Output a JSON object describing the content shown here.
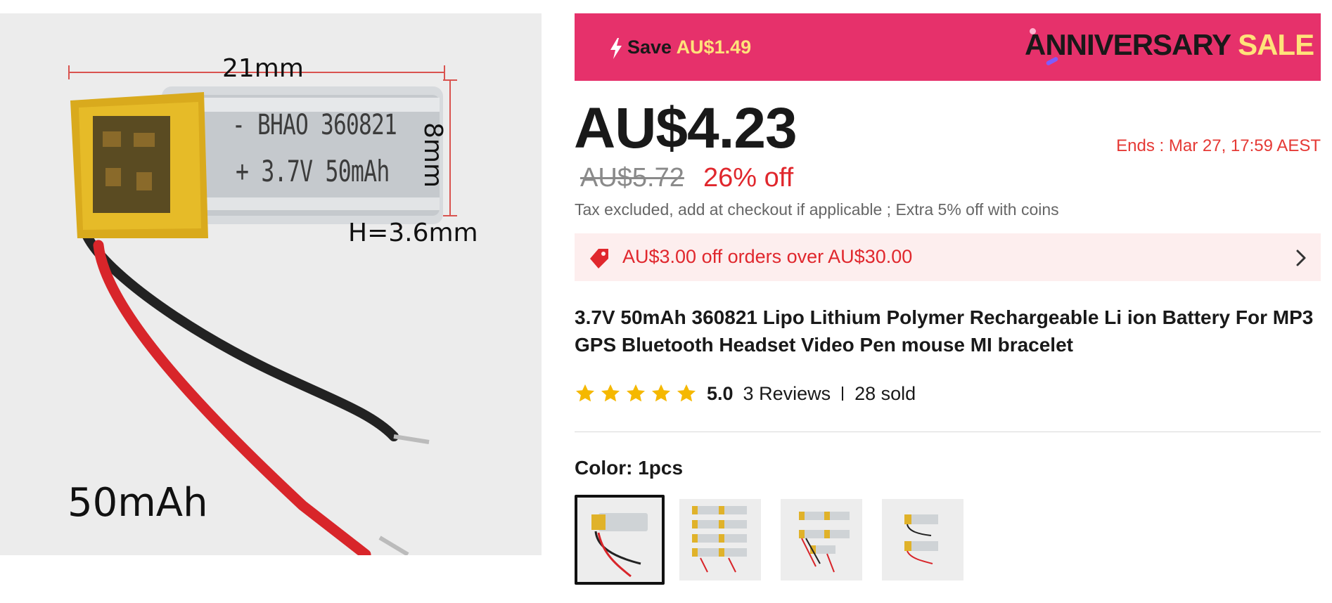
{
  "main_image": {
    "dim_width": "21mm",
    "dim_height": "8mm",
    "dim_thickness": "H=3.6mm",
    "capacity_label": "50mAh",
    "battery_print_line1": "- BHAO 360821",
    "battery_print_line2": "+ 3.7V 50mAh"
  },
  "banner": {
    "save_prefix": "Save",
    "save_amount": "AU$1.49",
    "event_word": "ANNIVERSARY",
    "event_sale": "SALE"
  },
  "price": {
    "current": "AU$4.23",
    "original": "AU$5.72",
    "discount": "26% off",
    "ends": "Ends :  Mar 27, 17:59 AEST",
    "tax_note": "Tax excluded, add at checkout if applicable ; Extra 5% off with coins"
  },
  "coupon": {
    "text": "AU$3.00 off orders over AU$30.00"
  },
  "product": {
    "title": "3.7V 50mAh 360821 Lipo Lithium Polymer Rechargeable Li ion Battery For MP3 GPS Bluetooth Headset Video Pen mouse MI bracelet"
  },
  "rating": {
    "stars": 5,
    "value": "5.0",
    "reviews": "3 Reviews",
    "sold": "28 sold"
  },
  "variants": {
    "label": "Color: 1pcs",
    "selected_index": 0,
    "options_count": 4
  },
  "colors": {
    "banner": "#e6316b",
    "accent_red": "#e0272d",
    "star": "#f5b800",
    "coupon_bg": "#fdeeee"
  }
}
